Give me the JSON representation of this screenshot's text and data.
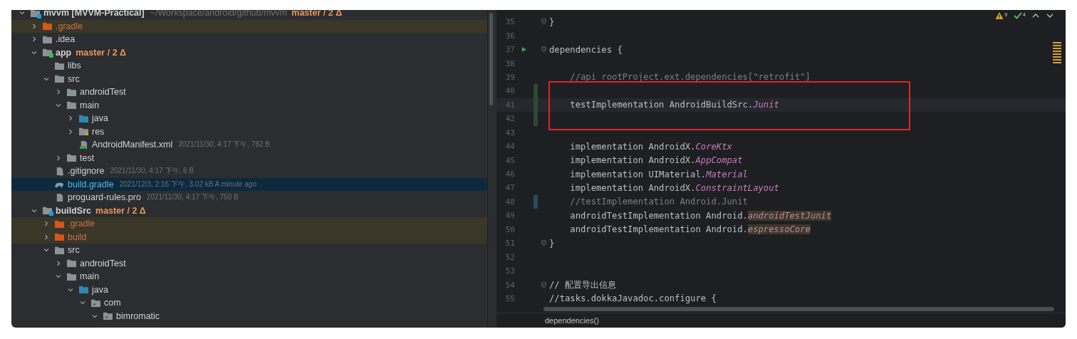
{
  "project_tree": [
    {
      "name": "mvvm [MVVM-Practical]",
      "kind": "module",
      "color": "#1e9bd7",
      "path": "~/Workspace/android/github/mvvm",
      "branch": "master / 2 Δ",
      "expanded": true,
      "selected": false,
      "modified": false,
      "children": [
        {
          "name": ".gradle",
          "kind": "excluded",
          "expanded": false,
          "selected": false,
          "modified": false
        },
        {
          "name": ".idea",
          "kind": "folder",
          "expanded": false,
          "selected": false,
          "modified": false
        },
        {
          "name": "app",
          "kind": "module",
          "color": "#2fbf4a",
          "branch": "master / 2 Δ",
          "expanded": true,
          "selected": false,
          "modified": false,
          "children": [
            {
              "name": "libs",
              "kind": "folder",
              "selected": false,
              "modified": false
            },
            {
              "name": "src",
              "kind": "folder",
              "expanded": true,
              "selected": false,
              "modified": false,
              "children": [
                {
                  "name": "androidTest",
                  "kind": "folder",
                  "expanded": false,
                  "selected": false,
                  "modified": false
                },
                {
                  "name": "main",
                  "kind": "folder",
                  "expanded": true,
                  "selected": false,
                  "modified": false,
                  "children": [
                    {
                      "name": "java",
                      "kind": "source",
                      "expanded": false,
                      "selected": false,
                      "modified": false
                    },
                    {
                      "name": "res",
                      "kind": "resources",
                      "expanded": false,
                      "selected": false,
                      "modified": false
                    },
                    {
                      "name": "AndroidManifest.xml",
                      "kind": "manifest",
                      "meta": "2021/11/30, 4:17 下午, 782 B",
                      "selected": false,
                      "modified": false
                    }
                  ]
                },
                {
                  "name": "test",
                  "kind": "folder",
                  "expanded": false,
                  "selected": false,
                  "modified": false
                }
              ]
            },
            {
              "name": ".gitignore",
              "kind": "gitignore",
              "meta": "2021/11/30, 4:17 下午, 6 B",
              "selected": false,
              "modified": false
            },
            {
              "name": "build.gradle",
              "kind": "gradle",
              "meta": "2021/12/3, 2:16 下午, 3.02 kB A minute ago",
              "selected": true,
              "modified": true
            },
            {
              "name": "proguard-rules.pro",
              "kind": "text",
              "meta": "2021/11/30, 4:17 下午, 750 B",
              "selected": false,
              "modified": false
            }
          ]
        },
        {
          "name": "buildSrc",
          "kind": "module",
          "color": "#1e9bd7",
          "branch": "master / 2 Δ",
          "expanded": true,
          "selected": false,
          "modified": false,
          "children": [
            {
              "name": ".gradle",
              "kind": "excluded",
              "expanded": false,
              "selected": false,
              "modified": false
            },
            {
              "name": "build",
              "kind": "excluded",
              "expanded": false,
              "selected": false,
              "modified": false
            },
            {
              "name": "src",
              "kind": "folder",
              "expanded": true,
              "selected": false,
              "modified": false,
              "children": [
                {
                  "name": "androidTest",
                  "kind": "folder",
                  "expanded": false,
                  "selected": false,
                  "modified": false
                },
                {
                  "name": "main",
                  "kind": "folder",
                  "expanded": true,
                  "selected": false,
                  "modified": false,
                  "children": [
                    {
                      "name": "java",
                      "kind": "source",
                      "expanded": true,
                      "selected": false,
                      "modified": false,
                      "children": [
                        {
                          "name": "com",
                          "kind": "package",
                          "expanded": true,
                          "selected": false,
                          "modified": false,
                          "children": [
                            {
                              "name": "bimromatic",
                              "kind": "package",
                              "expanded": true,
                              "selected": false,
                              "modified": false
                            }
                          ]
                        }
                      ]
                    }
                  ]
                }
              ]
            }
          ]
        }
      ]
    }
  ],
  "editor": {
    "inspections": [
      {
        "kind": "warning",
        "count": "9"
      },
      {
        "kind": "ok",
        "count": "4"
      }
    ],
    "lines": [
      {
        "number": "35",
        "fold": true,
        "segments": [
          {
            "text": "}",
            "kind": "plain"
          }
        ]
      },
      {
        "number": "36"
      },
      {
        "number": "37",
        "fold": true,
        "run": true,
        "segments": [
          {
            "text": "dependencies {",
            "kind": "plain"
          }
        ]
      },
      {
        "number": "38"
      },
      {
        "number": "39",
        "segments": [
          {
            "text": "    //api rootProject.ext.dependencies[\"retrofit\"]",
            "kind": "comment"
          }
        ]
      },
      {
        "number": "40",
        "added": true,
        "framed": true
      },
      {
        "number": "41",
        "added": true,
        "framed": true,
        "current": true,
        "segments": [
          {
            "text": "    testImplementation AndroidBuildSrc.",
            "kind": "plain"
          },
          {
            "text": "Junit",
            "kind": "field"
          }
        ]
      },
      {
        "number": "42",
        "added": true,
        "framed": true
      },
      {
        "number": "43"
      },
      {
        "number": "44",
        "segments": [
          {
            "text": "    implementation AndroidX.",
            "kind": "plain"
          },
          {
            "text": "CoreKtx",
            "kind": "field"
          }
        ]
      },
      {
        "number": "45",
        "segments": [
          {
            "text": "    implementation AndroidX.",
            "kind": "plain"
          },
          {
            "text": "AppCompat",
            "kind": "field"
          }
        ]
      },
      {
        "number": "46",
        "segments": [
          {
            "text": "    implementation UIMaterial.",
            "kind": "plain"
          },
          {
            "text": "Material",
            "kind": "field"
          }
        ]
      },
      {
        "number": "47",
        "segments": [
          {
            "text": "    implementation AndroidX.",
            "kind": "plain"
          },
          {
            "text": "ConstraintLayout",
            "kind": "field"
          }
        ]
      },
      {
        "number": "48",
        "edited": true,
        "segments": [
          {
            "text": "    //testImplementation Android.Junit",
            "kind": "comment"
          }
        ]
      },
      {
        "number": "49",
        "segments": [
          {
            "text": "    androidTestImplementation Android.",
            "kind": "plain"
          },
          {
            "text": "androidTestJunit",
            "kind": "field-marked"
          }
        ]
      },
      {
        "number": "50",
        "segments": [
          {
            "text": "    androidTestImplementation Android.",
            "kind": "plain"
          },
          {
            "text": "espressoCore",
            "kind": "field-marked"
          }
        ]
      },
      {
        "number": "51",
        "fold": true,
        "segments": [
          {
            "text": "}",
            "kind": "plain"
          }
        ]
      },
      {
        "number": "52"
      },
      {
        "number": "53"
      },
      {
        "number": "54",
        "fold": true,
        "segments": [
          {
            "text": "// 配置导出信息",
            "kind": "plain"
          }
        ]
      },
      {
        "number": "55",
        "segments": [
          {
            "text": "//tasks.dokkaJavadoc.configure {",
            "kind": "plain"
          }
        ]
      }
    ],
    "breadcrumb": "dependencies()"
  }
}
